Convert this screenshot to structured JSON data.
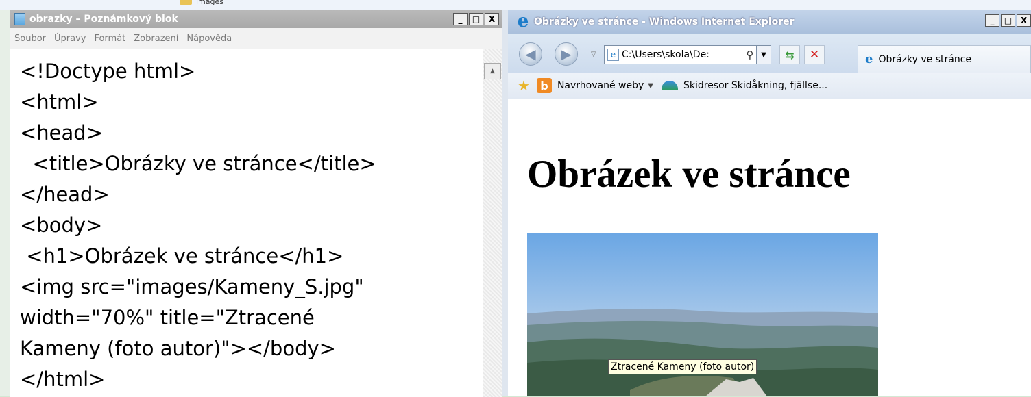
{
  "background_window": {
    "label": "images"
  },
  "notepad": {
    "title": "obrazky – Poznámkový blok",
    "menu": [
      "Soubor",
      "Úpravy",
      "Formát",
      "Zobrazení",
      "Nápověda"
    ],
    "content": "<!Doctype html>\n<html>\n<head>\n  <title>Obrázky ve stránce</title>\n</head>\n<body>\n <h1>Obrázek ve stránce</h1>\n<img src=\"images/Kameny_S.jpg\"\nwidth=\"70%\" title=\"Ztracené\nKameny (foto autor)\"></body>\n</html>"
  },
  "window_buttons": {
    "minimize": "_",
    "maximize": "□",
    "close": "X"
  },
  "browser": {
    "title": "Obrázky ve stránce - Windows Internet Explorer",
    "address": "C:\\Users\\skola\\De:",
    "tab_label": "Obrázky ve stránce",
    "favorites": [
      {
        "label": "Navrhované weby",
        "has_dropdown": true,
        "icon": "bing-icon"
      },
      {
        "label": "Skidresor Skidåkning, fjällse...",
        "icon": "skidresor-icon"
      }
    ],
    "page": {
      "heading": "Obrázek ve stránce",
      "tooltip": "Ztracené Kameny (foto autor)"
    }
  }
}
